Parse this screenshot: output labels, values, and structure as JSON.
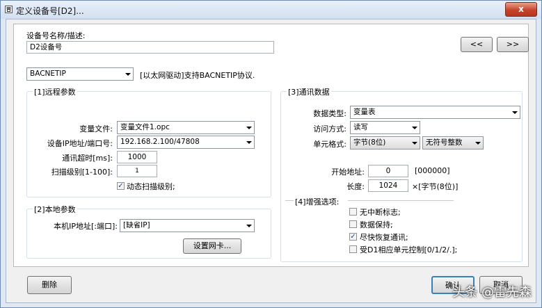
{
  "window": {
    "title": "定义设备号[D2]...",
    "close_label": "x"
  },
  "device": {
    "name_label": "设备号名称/描述:",
    "name_value": "D2设备号",
    "prev_label": "<<",
    "next_label": ">>"
  },
  "driver": {
    "selected": "BACNETIP",
    "description": "[以太网驱动]支持BACNETIP协议."
  },
  "remote": {
    "title": "[1]远程参数",
    "var_file_label": "变量文件:",
    "var_file_value": "变量文件1.opc",
    "ip_label": "设备IP地址/端口号:",
    "ip_value": "192.168.2.100/47808",
    "timeout_label": "通讯超时[ms]:",
    "timeout_value": "1000",
    "scan_label": "扫描级别[1-100]:",
    "scan_value": "1",
    "dynamic_scan_label": "动态扫描级别;",
    "dynamic_scan_checked": true
  },
  "local": {
    "title": "[2]本地参数",
    "local_ip_label": "本机IP地址[:端口]:",
    "local_ip_value": "[缺省IP]",
    "setup_nic_label": "设置网卡..."
  },
  "comm": {
    "title": "[3]通讯数据",
    "data_type_label": "数据类型:",
    "data_type_value": "变量表",
    "access_label": "访问方式:",
    "access_value": "读写",
    "unit_label": "单元格式:",
    "unit_value": "字节(8位)",
    "sign_value": "无符号整数",
    "start_label": "开始地址:",
    "start_value": "0",
    "start_hex": "[000000]",
    "length_label": "长度:",
    "length_value": "1024",
    "length_unit": "×[字节(8位)]"
  },
  "enhance": {
    "title": "[4]增强选项:",
    "options": [
      {
        "label": "无中断标志;",
        "checked": false
      },
      {
        "label": "数据保持;",
        "checked": false
      },
      {
        "label": "尽快恢复通讯;",
        "checked": true
      },
      {
        "label": "受D1相应单元控制[0/1/2/.];",
        "checked": false
      }
    ]
  },
  "footer": {
    "delete_label": "删除",
    "ok_label": "确认",
    "cancel_label": "取消"
  },
  "watermark": "头条 @雷先森"
}
